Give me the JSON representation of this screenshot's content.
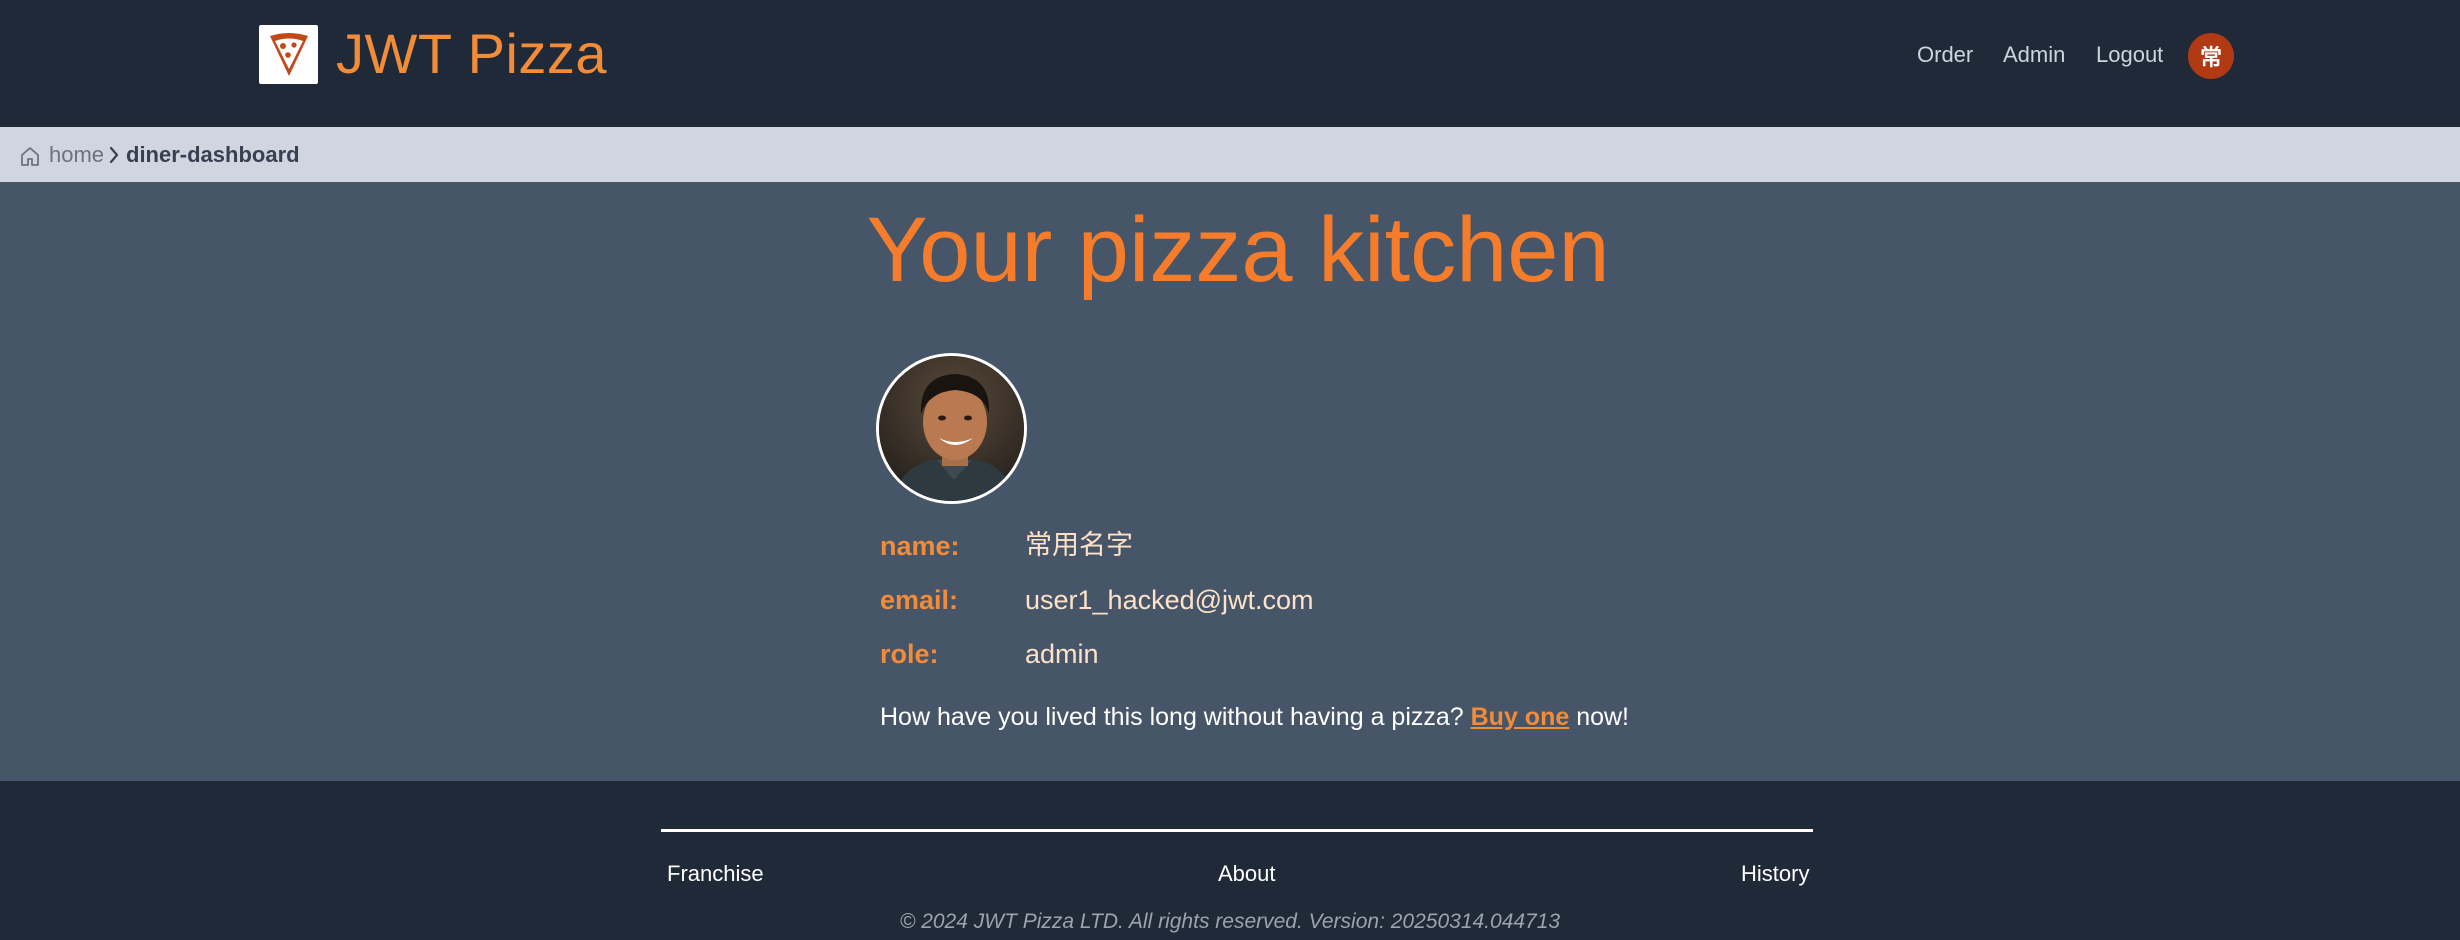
{
  "header": {
    "brand": "JWT Pizza",
    "nav": {
      "order": "Order",
      "admin": "Admin",
      "logout": "Logout"
    },
    "user_initial": "常"
  },
  "breadcrumb": {
    "home": "home",
    "current": "diner-dashboard"
  },
  "main": {
    "title": "Your pizza kitchen",
    "profile": {
      "name_label": "name:",
      "name_value": "常用名字",
      "email_label": "email:",
      "email_value": "user1_hacked@jwt.com",
      "role_label": "role:",
      "role_value": "admin"
    },
    "cta": {
      "prefix": "How have you lived this long without having a pizza? ",
      "link": "Buy one",
      "suffix": " now!"
    }
  },
  "footer": {
    "links": {
      "franchise": "Franchise",
      "about": "About",
      "history": "History"
    },
    "copyright": "© 2024 JWT Pizza LTD. All rights reserved. Version: 20250314.044713"
  },
  "colors": {
    "header_bg": "#1f2937",
    "main_bg": "#475569",
    "breadcrumb_bg": "#d1d5e0",
    "accent": "#f28c38",
    "avatar_bg": "#b23a12"
  },
  "icons": [
    "pizza-slice-icon",
    "home-icon",
    "chevron-right-icon"
  ]
}
